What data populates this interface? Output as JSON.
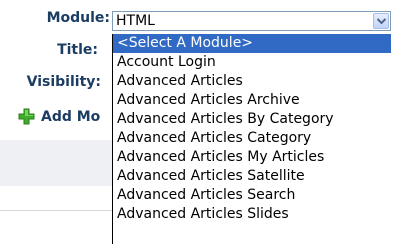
{
  "form": {
    "module_label": "Module:",
    "title_label": "Title:",
    "visibility_label": "Visibility:",
    "add_module_label": "Add Mo"
  },
  "module_select": {
    "selected_value": "HTML"
  },
  "dropdown": {
    "options": [
      "<Select A Module>",
      "Account Login",
      "Advanced Articles",
      "Advanced Articles Archive",
      "Advanced Articles By Category",
      "Advanced Articles Category",
      "Advanced Articles My Articles",
      "Advanced Articles Satellite",
      "Advanced Articles Search",
      "Advanced Articles Slides"
    ],
    "highlighted_index": 0
  },
  "icons": {
    "add": "plus-icon",
    "dropdown": "chevron-down-icon"
  },
  "colors": {
    "label_text": "#1c3d63",
    "selection_highlight": "#316ac5",
    "add_icon_green": "#3fae2a"
  }
}
